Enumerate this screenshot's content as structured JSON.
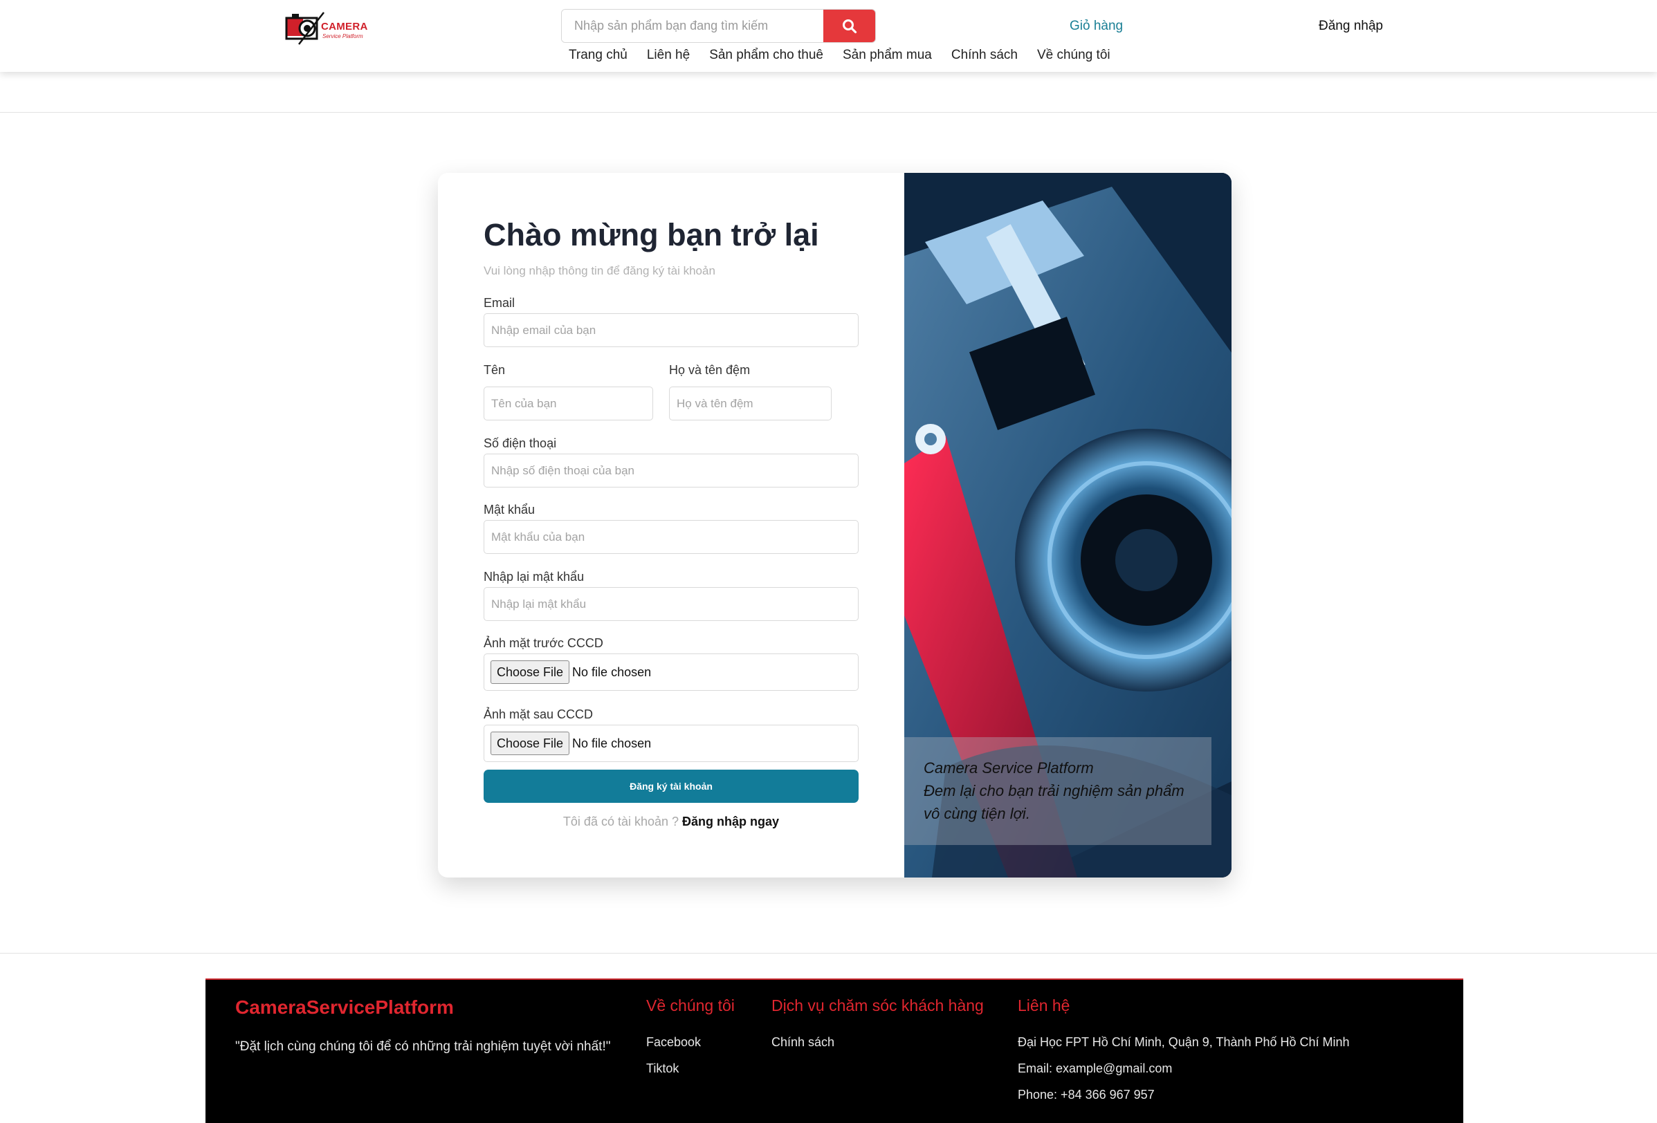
{
  "header": {
    "logo_text": "CAMERA",
    "logo_subtext": "Service Platform",
    "search_placeholder": "Nhập sản phẩm bạn đang tìm kiếm",
    "cart_label": "Giỏ hàng",
    "login_label": "Đăng nhập",
    "nav": [
      "Trang chủ",
      "Liên hệ",
      "Sản phẩm cho thuê",
      "Sản phẩm mua",
      "Chính sách",
      "Về chúng tôi"
    ]
  },
  "form": {
    "title": "Chào mừng bạn trở lại",
    "subtitle": "Vui lòng nhập thông tin để đăng ký tài khoản",
    "email_label": "Email",
    "email_placeholder": "Nhập email của bạn",
    "first_name_label": "Tên",
    "first_name_placeholder": "Tên của bạn",
    "last_name_label": "Họ và tên đệm",
    "last_name_placeholder": "Họ và tên đệm",
    "phone_label": "Số điện thoại",
    "phone_placeholder": "Nhập số điện thoại của bạn",
    "password_label": "Mật khẩu",
    "password_placeholder": "Mật khẩu của bạn",
    "confirm_label": "Nhập lại mật khẩu",
    "confirm_placeholder": "Nhập lại mật khẩu",
    "id_front_label": "Ảnh mặt trước CCCD",
    "id_back_label": "Ảnh mặt sau CCCD",
    "choose_file": "Choose File",
    "no_file": "No file chosen",
    "submit_label": "Đăng ký tài khoản",
    "has_account": "Tôi đã có tài khoản ?",
    "login_now": "Đăng nhập ngay"
  },
  "image_caption": {
    "line1": "Camera Service Platform",
    "line2": "Đem lại cho bạn trải nghiệm sản phẩm vô cùng tiện lợi."
  },
  "footer": {
    "brand": "CameraServicePlatform",
    "quote": "\"Đặt lịch cùng chúng tôi để có những trải nghiệm tuyệt vời nhất!\"",
    "about_heading": "Về chúng tôi",
    "about_items": [
      "Facebook",
      "Tiktok"
    ],
    "service_heading": "Dịch vụ chăm sóc khách hàng",
    "service_items": [
      "Chính sách"
    ],
    "contact_heading": "Liên hệ",
    "contact_items": [
      "Đại Học FPT Hồ Chí Minh, Quận 9, Thành Phố Hồ Chí Minh",
      "Email: example@gmail.com",
      "Phone: +84 366 967 957"
    ]
  },
  "colors": {
    "accent_red": "#e5383b",
    "primary_teal": "#127c99",
    "cart_link": "#1a7f95"
  }
}
